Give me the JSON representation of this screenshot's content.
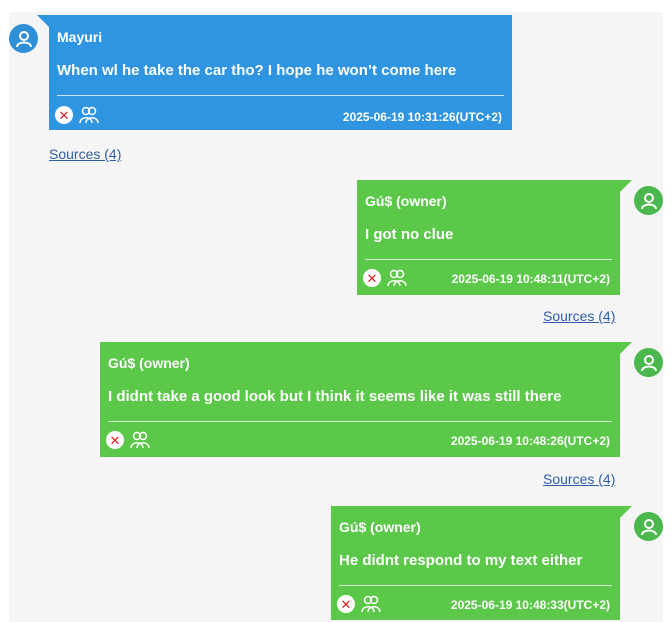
{
  "colors": {
    "incoming_bubble": "#2f95e0",
    "outgoing_bubble": "#5cc84a",
    "avatar_blue": "#2f8fd6",
    "avatar_green": "#4ab84d",
    "delete_icon": "#d92424",
    "link": "#2f5fa8"
  },
  "messages": [
    {
      "direction": "incoming",
      "sender": "Mayuri",
      "text": "When wl he take the car tho? I hope he won’t come here",
      "timestamp": "2025-06-19 10:31:26(UTC+2)",
      "sources": "Sources (4)"
    },
    {
      "direction": "outgoing",
      "sender": "Gú$ (owner)",
      "text": "I got no clue",
      "timestamp": "2025-06-19 10:48:11(UTC+2)",
      "sources": "Sources (4)"
    },
    {
      "direction": "outgoing",
      "sender": "Gú$ (owner)",
      "text": "I didnt take a good look but I think it seems like it was still there",
      "timestamp": "2025-06-19 10:48:26(UTC+2)",
      "sources": "Sources (4)"
    },
    {
      "direction": "outgoing",
      "sender": "Gú$ (owner)",
      "text": "He didnt respond to my text either",
      "timestamp": "2025-06-19 10:48:33(UTC+2)"
    }
  ],
  "icons": {
    "avatar": "user-avatar-icon",
    "delete": "close-circle-icon",
    "participants": "group-icon"
  }
}
